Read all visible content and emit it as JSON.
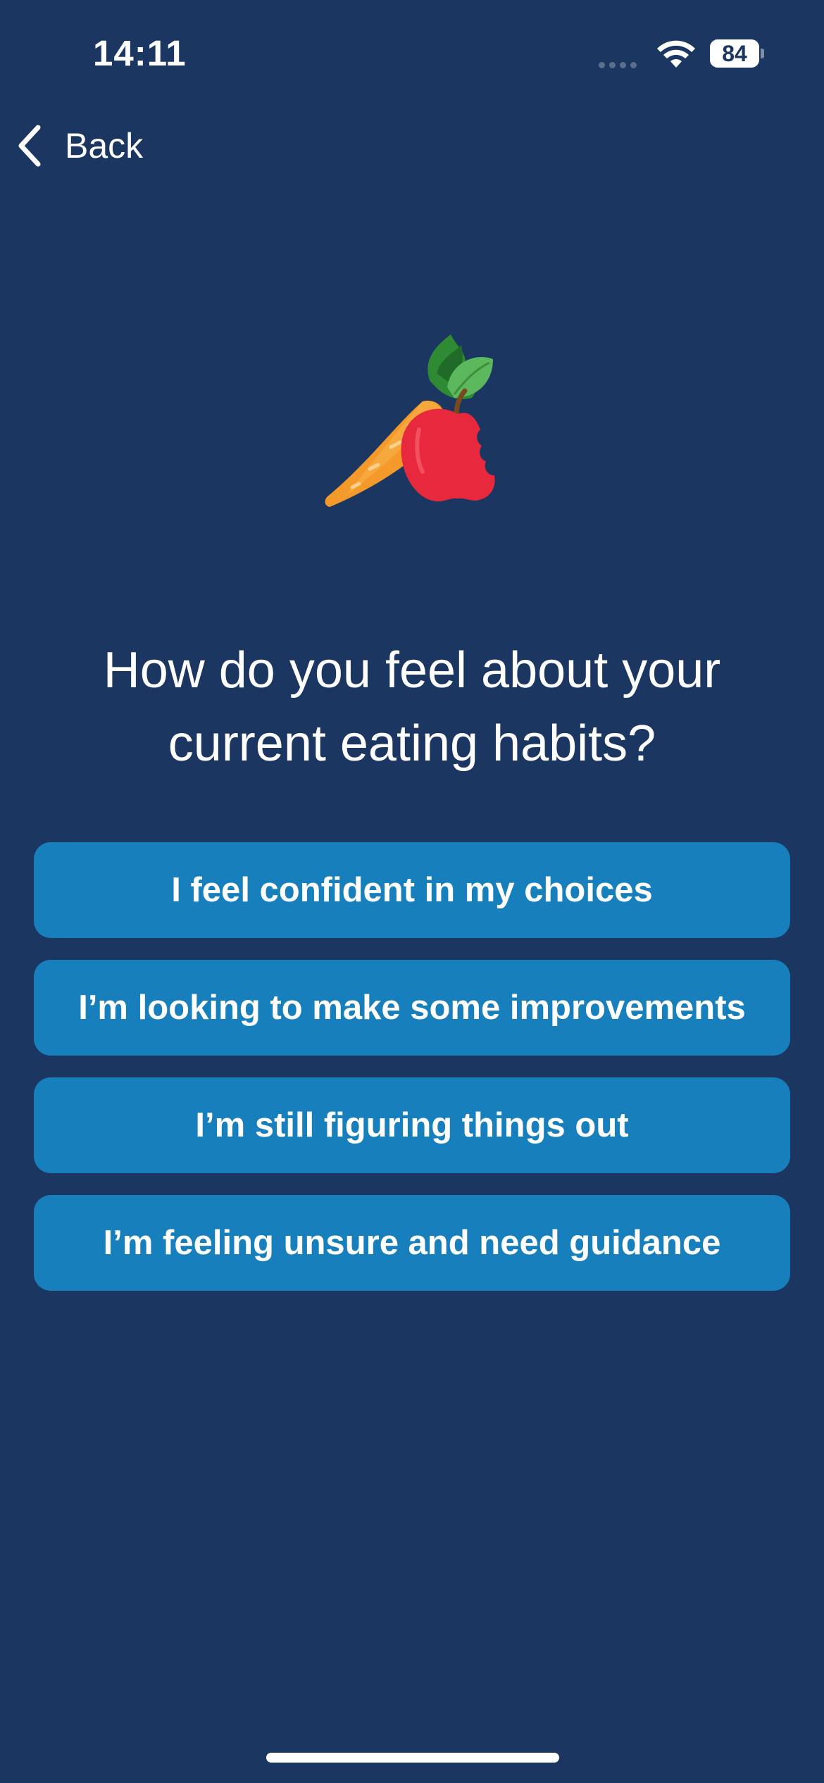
{
  "status_bar": {
    "time": "14:11",
    "battery": "84",
    "icons": [
      "cellular-signal-icon",
      "wifi-icon",
      "battery-icon"
    ]
  },
  "nav": {
    "back_label": "Back",
    "back_icon": "chevron-left-icon"
  },
  "illustration": {
    "icon": "carrot-apple-icon"
  },
  "question": {
    "text": "How do you feel about your current eating habits?"
  },
  "options": [
    {
      "label": "I feel confident in my choices"
    },
    {
      "label": "I’m looking to make some improvements"
    },
    {
      "label": "I’m still figuring things out"
    },
    {
      "label": "I’m feeling unsure and need guidance"
    }
  ],
  "colors": {
    "background": "#1b3761",
    "option_button": "#167fbc",
    "text": "#ffffff"
  }
}
